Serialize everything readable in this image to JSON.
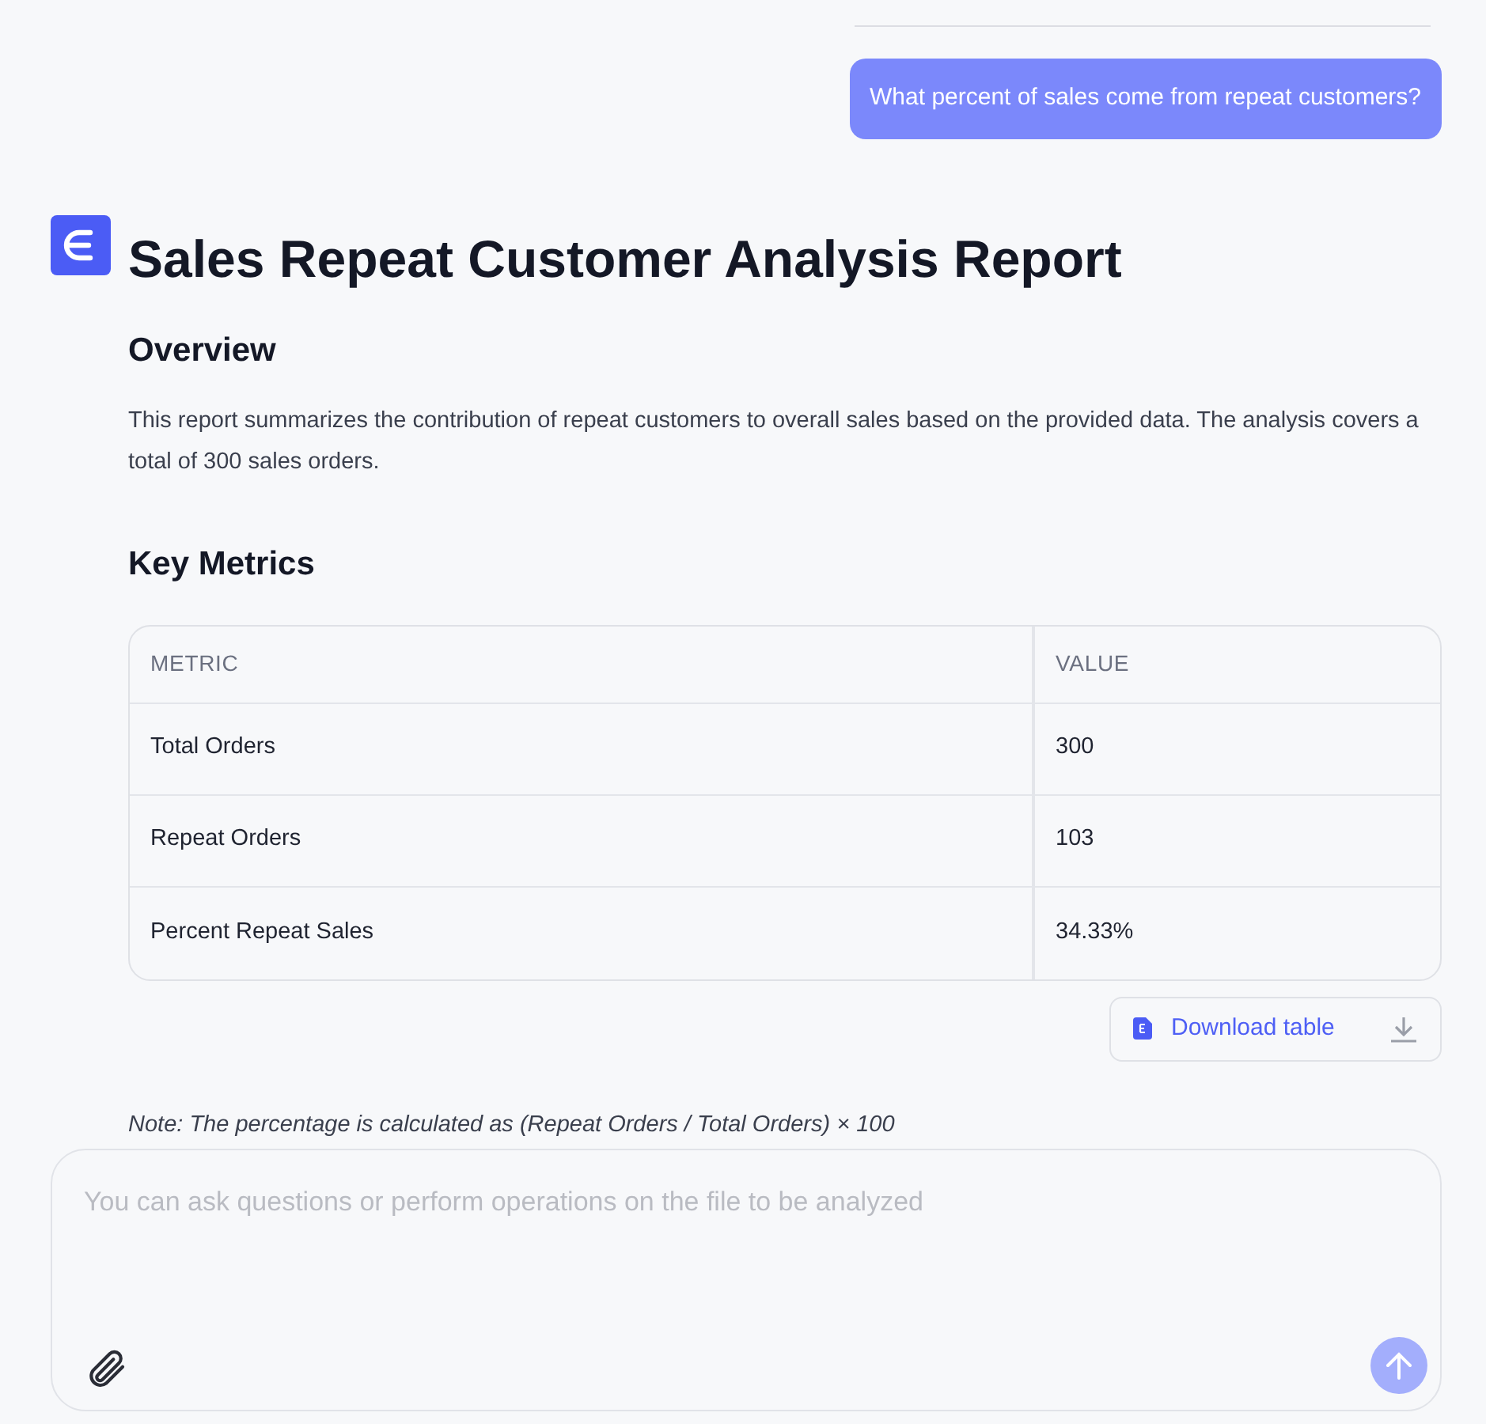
{
  "user_message": "What percent of sales come from repeat customers?",
  "report": {
    "title": "Sales Repeat Customer Analysis Report",
    "sections": [
      {
        "heading": "Overview",
        "paragraph": "This report summarizes the contribution of repeat customers to overall sales based on the provided data. The analysis covers a total of 300 sales orders."
      },
      {
        "heading": "Key Metrics"
      }
    ],
    "table": {
      "columns": [
        "METRIC",
        "VALUE"
      ],
      "rows": [
        [
          "Total Orders",
          "300"
        ],
        [
          "Repeat Orders",
          "103"
        ],
        [
          "Percent Repeat Sales",
          "34.33%"
        ]
      ]
    },
    "download_button": "Download table",
    "note": "*Note:* The percentage is calculated as (Repeat Orders / Total Orders) × 100"
  },
  "composer": {
    "placeholder": "You can ask questions or perform operations on the file to be analyzed"
  }
}
